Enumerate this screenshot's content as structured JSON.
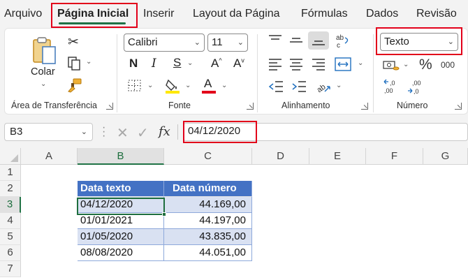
{
  "menu": {
    "tabs": [
      "Arquivo",
      "Página Inicial",
      "Inserir",
      "Layout da Página",
      "Fórmulas",
      "Dados",
      "Revisão"
    ]
  },
  "ribbon": {
    "clipboard": {
      "paste_label": "Colar",
      "group_label": "Área de Transferência"
    },
    "font": {
      "name": "Calibri",
      "size": "11",
      "bold": "N",
      "group_label": "Fonte"
    },
    "alignment": {
      "group_label": "Alinhamento"
    },
    "number": {
      "format": "Texto",
      "percent": "%",
      "thousands": "000",
      "group_label": "Número"
    }
  },
  "formula_bar": {
    "name_box": "B3",
    "fx": "fx",
    "value": "04/12/2020"
  },
  "sheet": {
    "columns": [
      "A",
      "B",
      "C",
      "D",
      "E",
      "F",
      "G"
    ],
    "rows": [
      "1",
      "2",
      "3",
      "4",
      "5",
      "6",
      "7"
    ],
    "active_cell": "B3",
    "table": {
      "headers": [
        "Data texto",
        "Data número"
      ],
      "rows": [
        [
          "04/12/2020",
          "44.169,00"
        ],
        [
          "01/01/2021",
          "44.197,00"
        ],
        [
          "01/05/2020",
          "43.835,00"
        ],
        [
          "08/08/2020",
          "44.051,00"
        ]
      ]
    }
  },
  "colors": {
    "accent_green": "#1e7145",
    "highlight_red": "#e2001a",
    "table_header": "#4472c4",
    "table_band": "#d9e1f2",
    "font_color": "#e2001a",
    "fill_color": "#ffe800"
  },
  "icons": [
    "paste-icon",
    "cut-icon",
    "copy-icon",
    "format-painter-icon",
    "font-grow-icon",
    "font-shrink-icon",
    "borders-icon",
    "fill-color-icon",
    "font-color-icon",
    "align-top-icon",
    "align-middle-icon",
    "align-bottom-icon",
    "wrap-text-icon",
    "align-left-icon",
    "align-center-icon",
    "align-right-icon",
    "merge-center-icon",
    "decrease-indent-icon",
    "increase-indent-icon",
    "orientation-icon",
    "currency-icon",
    "increase-decimal-icon",
    "decrease-decimal-icon",
    "dialog-launcher-icon"
  ]
}
